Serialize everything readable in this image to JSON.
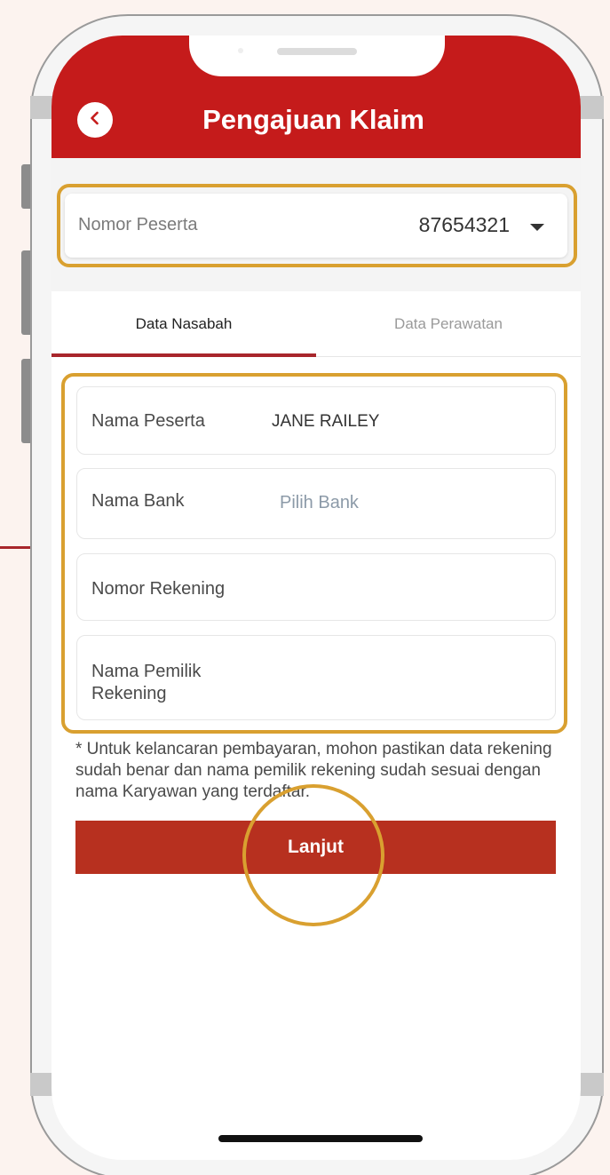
{
  "header": {
    "title": "Pengajuan Klaim",
    "back_icon": "chevron-left-icon",
    "color": "#c51b1b"
  },
  "participant": {
    "label": "Nomor Peserta",
    "value": "87654321",
    "dropdown_icon": "caret-down-icon"
  },
  "tabs": [
    {
      "label": "Data Nasabah",
      "active": true
    },
    {
      "label": "Data Perawatan",
      "active": false
    }
  ],
  "form": {
    "participant_name": {
      "label": "Nama Peserta",
      "value": "JANE RAILEY"
    },
    "bank_name": {
      "label": "Nama Bank",
      "placeholder": "Pilih Bank"
    },
    "account_number": {
      "label": "Nomor Rekening",
      "value": ""
    },
    "account_holder": {
      "label": "Nama Pemilik Rekening",
      "label_line1": "Nama Pemilik",
      "label_line2": "Rekening",
      "value": ""
    }
  },
  "note": "* Untuk kelancaran pembayaran, mohon pastikan data rekening sudah benar dan nama pemilik rekening sudah sesuai dengan nama Karyawan yang terdaftar.",
  "next_button": {
    "label": "Lanjut",
    "color": "#b7301f"
  },
  "highlight_color": "#d9a030"
}
